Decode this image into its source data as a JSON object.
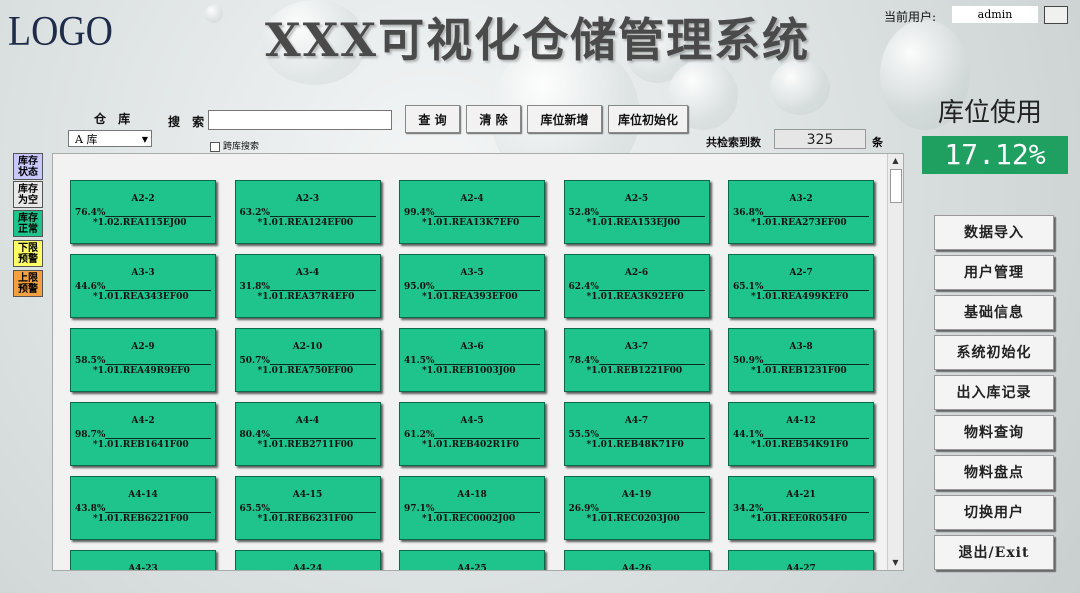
{
  "header": {
    "logo": "LOGO",
    "title": "XXX可视化仓储管理系统",
    "current_user_label": "当前用户:",
    "current_user": "admin"
  },
  "toolbar": {
    "warehouse_label": "仓 库",
    "warehouse_value": "A 库",
    "search_label": "搜 索",
    "search_value": "",
    "query_button": "查 询",
    "clear_button": "清 除",
    "add_slot_button": "库位新增",
    "init_slot_button": "库位初始化",
    "cross_search_label": "跨库搜索",
    "count_label": "共检索到数",
    "count_value": "325",
    "count_unit": "条"
  },
  "usage": {
    "title": "库位使用",
    "value": "17.12%"
  },
  "legend": [
    {
      "label": "库存状态",
      "color": "#c8c8ff"
    },
    {
      "label": "库存为空",
      "color": "#e8e8e8"
    },
    {
      "label": "库存正常",
      "color": "#1ec48b"
    },
    {
      "label": "下限预警",
      "color": "#ffff66"
    },
    {
      "label": "上限预警",
      "color": "#f4a040"
    }
  ],
  "slots": [
    {
      "code": "A2-2",
      "pct": "76.4%",
      "part": "*1.02.REA115EJ00"
    },
    {
      "code": "A2-3",
      "pct": "63.2%",
      "part": "*1.01.REA124EF00"
    },
    {
      "code": "A2-4",
      "pct": "99.4%",
      "part": "*1.01.REA13K7EF0"
    },
    {
      "code": "A2-5",
      "pct": "52.8%",
      "part": "*1.01.REA153EJ00"
    },
    {
      "code": "A3-2",
      "pct": "36.8%",
      "part": "*1.01.REA273EF00"
    },
    {
      "code": "A3-3",
      "pct": "44.6%",
      "part": "*1.01.REA343EF00"
    },
    {
      "code": "A3-4",
      "pct": "31.8%",
      "part": "*1.01.REA37R4EF0"
    },
    {
      "code": "A3-5",
      "pct": "95.0%",
      "part": "*1.01.REA393EF00"
    },
    {
      "code": "A2-6",
      "pct": "62.4%",
      "part": "*1.01.REA3K92EF0"
    },
    {
      "code": "A2-7",
      "pct": "65.1%",
      "part": "*1.01.REA499KEF0"
    },
    {
      "code": "A2-9",
      "pct": "58.5%",
      "part": "*1.01.REA49R9EF0"
    },
    {
      "code": "A2-10",
      "pct": "50.7%",
      "part": "*1.01.REA750EF00"
    },
    {
      "code": "A3-6",
      "pct": "41.5%",
      "part": "*1.01.REB1003J00"
    },
    {
      "code": "A3-7",
      "pct": "78.4%",
      "part": "*1.01.REB1221F00"
    },
    {
      "code": "A3-8",
      "pct": "50.9%",
      "part": "*1.01.REB1231F00"
    },
    {
      "code": "A4-2",
      "pct": "98.7%",
      "part": "*1.01.REB1641F00"
    },
    {
      "code": "A4-4",
      "pct": "80.4%",
      "part": "*1.01.REB2711F00"
    },
    {
      "code": "A4-5",
      "pct": "61.2%",
      "part": "*1.01.REB402R1F0"
    },
    {
      "code": "A4-7",
      "pct": "55.5%",
      "part": "*1.01.REB48K71F0"
    },
    {
      "code": "A4-12",
      "pct": "44.1%",
      "part": "*1.01.REB54K91F0"
    },
    {
      "code": "A4-14",
      "pct": "43.8%",
      "part": "*1.01.REB6221F00"
    },
    {
      "code": "A4-15",
      "pct": "65.5%",
      "part": "*1.01.REB6231F00"
    },
    {
      "code": "A4-18",
      "pct": "97.1%",
      "part": "*1.01.REC0002J00"
    },
    {
      "code": "A4-19",
      "pct": "26.9%",
      "part": "*1.01.REC0203J00"
    },
    {
      "code": "A4-21",
      "pct": "34.2%",
      "part": "*1.01.REE0R054F0"
    },
    {
      "code": "A4-23",
      "pct": "",
      "part": ""
    },
    {
      "code": "A4-24",
      "pct": "",
      "part": ""
    },
    {
      "code": "A4-25",
      "pct": "",
      "part": ""
    },
    {
      "code": "A4-26",
      "pct": "",
      "part": ""
    },
    {
      "code": "A4-27",
      "pct": "",
      "part": ""
    }
  ],
  "side_menu": [
    "数据导入",
    "用户管理",
    "基础信息",
    "系统初始化",
    "出入库记录",
    "物料查询",
    "物料盘点",
    "切换用户",
    "退出/Exit"
  ],
  "scrollbar": {
    "up_icon": "▲",
    "down_icon": "▼"
  }
}
